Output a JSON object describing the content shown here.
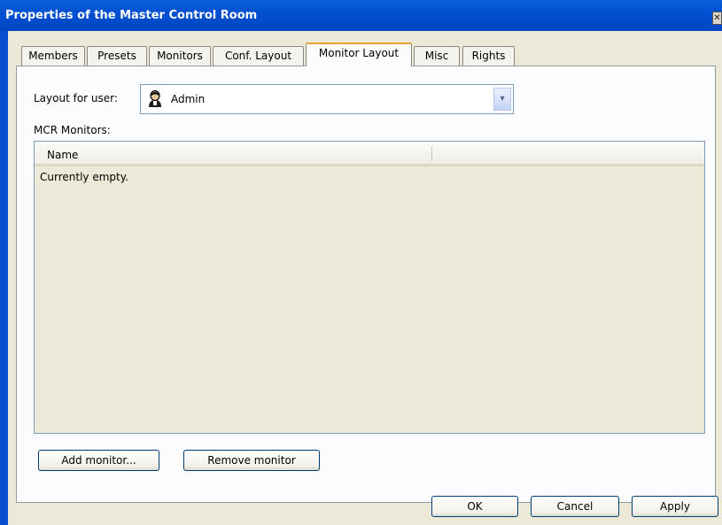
{
  "window": {
    "title": "Properties of the Master Control Room",
    "close_glyph": "✕"
  },
  "tabs": [
    {
      "label": "Members"
    },
    {
      "label": "Presets"
    },
    {
      "label": "Monitors"
    },
    {
      "label": "Conf. Layout"
    },
    {
      "label": "Monitor Layout",
      "active": true
    },
    {
      "label": "Misc"
    },
    {
      "label": "Rights"
    }
  ],
  "layout": {
    "label": "Layout for user:",
    "user_icon": "user-icon",
    "selected_user": "Admin",
    "arrow_glyph": "▾"
  },
  "mcr": {
    "label": "MCR Monitors:",
    "columns": [
      "Name"
    ],
    "empty_text": "Currently empty."
  },
  "buttons": {
    "add_monitor": "Add monitor...",
    "remove_monitor": "Remove monitor",
    "ok": "OK",
    "cancel": "Cancel",
    "apply": "Apply"
  },
  "colors": {
    "titlebar": "#0150d1",
    "dialog_bg": "#ece9d8",
    "active_tab_accent": "#e6a232"
  }
}
